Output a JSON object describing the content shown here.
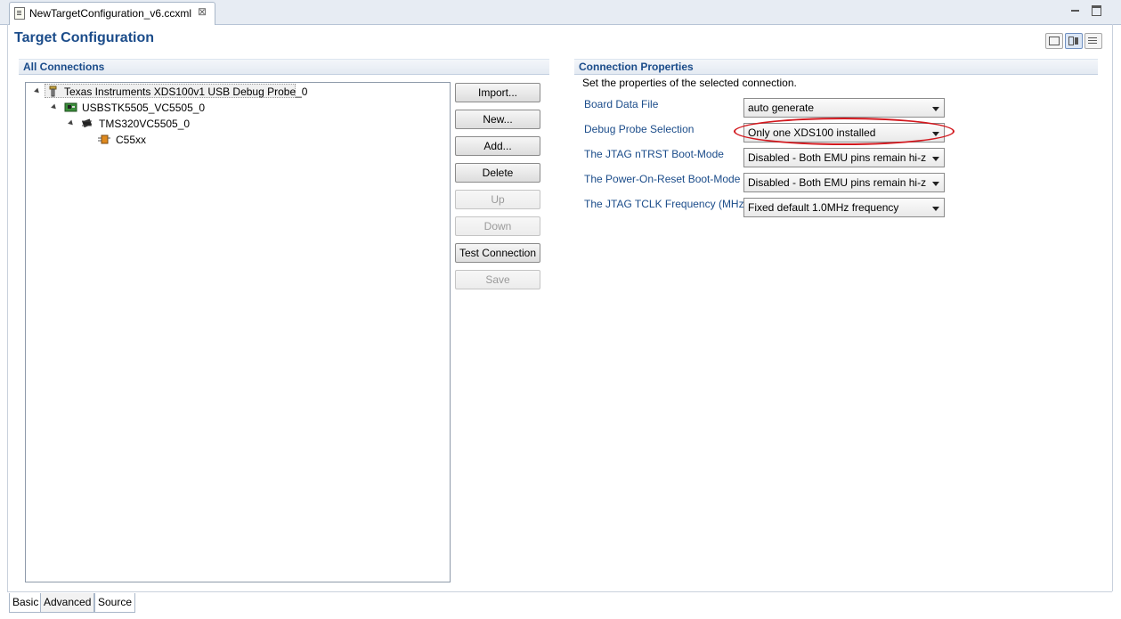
{
  "editor_tab": {
    "title": "NewTargetConfiguration_v6.ccxml",
    "close_glyph": "⊠"
  },
  "page": {
    "title": "Target Configuration"
  },
  "connections": {
    "header": "All Connections",
    "tree": [
      {
        "label": "Texas Instruments XDS100v1 USB Debug Probe_0",
        "icon": "debug-probe-icon",
        "expanded": true,
        "selected": true
      },
      {
        "label": "USBSTK5505_VC5505_0",
        "icon": "board-icon",
        "expanded": true
      },
      {
        "label": "TMS320VC5505_0",
        "icon": "chip-icon",
        "expanded": true
      },
      {
        "label": "C55xx",
        "icon": "cpu-core-icon"
      }
    ],
    "buttons": {
      "import": "Import...",
      "new": "New...",
      "add": "Add...",
      "delete": "Delete",
      "up": "Up",
      "down": "Down",
      "test_connection": "Test Connection",
      "save": "Save"
    }
  },
  "properties": {
    "header": "Connection Properties",
    "description": "Set the properties of the selected connection.",
    "fields": [
      {
        "label": "Board Data File",
        "value": "auto generate"
      },
      {
        "label": "Debug Probe Selection",
        "value": "Only one XDS100 installed"
      },
      {
        "label": "The JTAG nTRST Boot-Mode",
        "value": "Disabled - Both EMU pins remain hi-z"
      },
      {
        "label": "The Power-On-Reset Boot-Mode",
        "value": "Disabled - Both EMU pins remain hi-z"
      },
      {
        "label": "The JTAG TCLK Frequency (MHz)",
        "value": "Fixed default 1.0MHz frequency"
      }
    ]
  },
  "bottom_tabs": [
    {
      "label": "Basic"
    },
    {
      "label": "Advanced",
      "active": true
    },
    {
      "label": "Source"
    }
  ],
  "colors": {
    "accent": "#1b4c8a",
    "highlight": "#d2181e"
  }
}
